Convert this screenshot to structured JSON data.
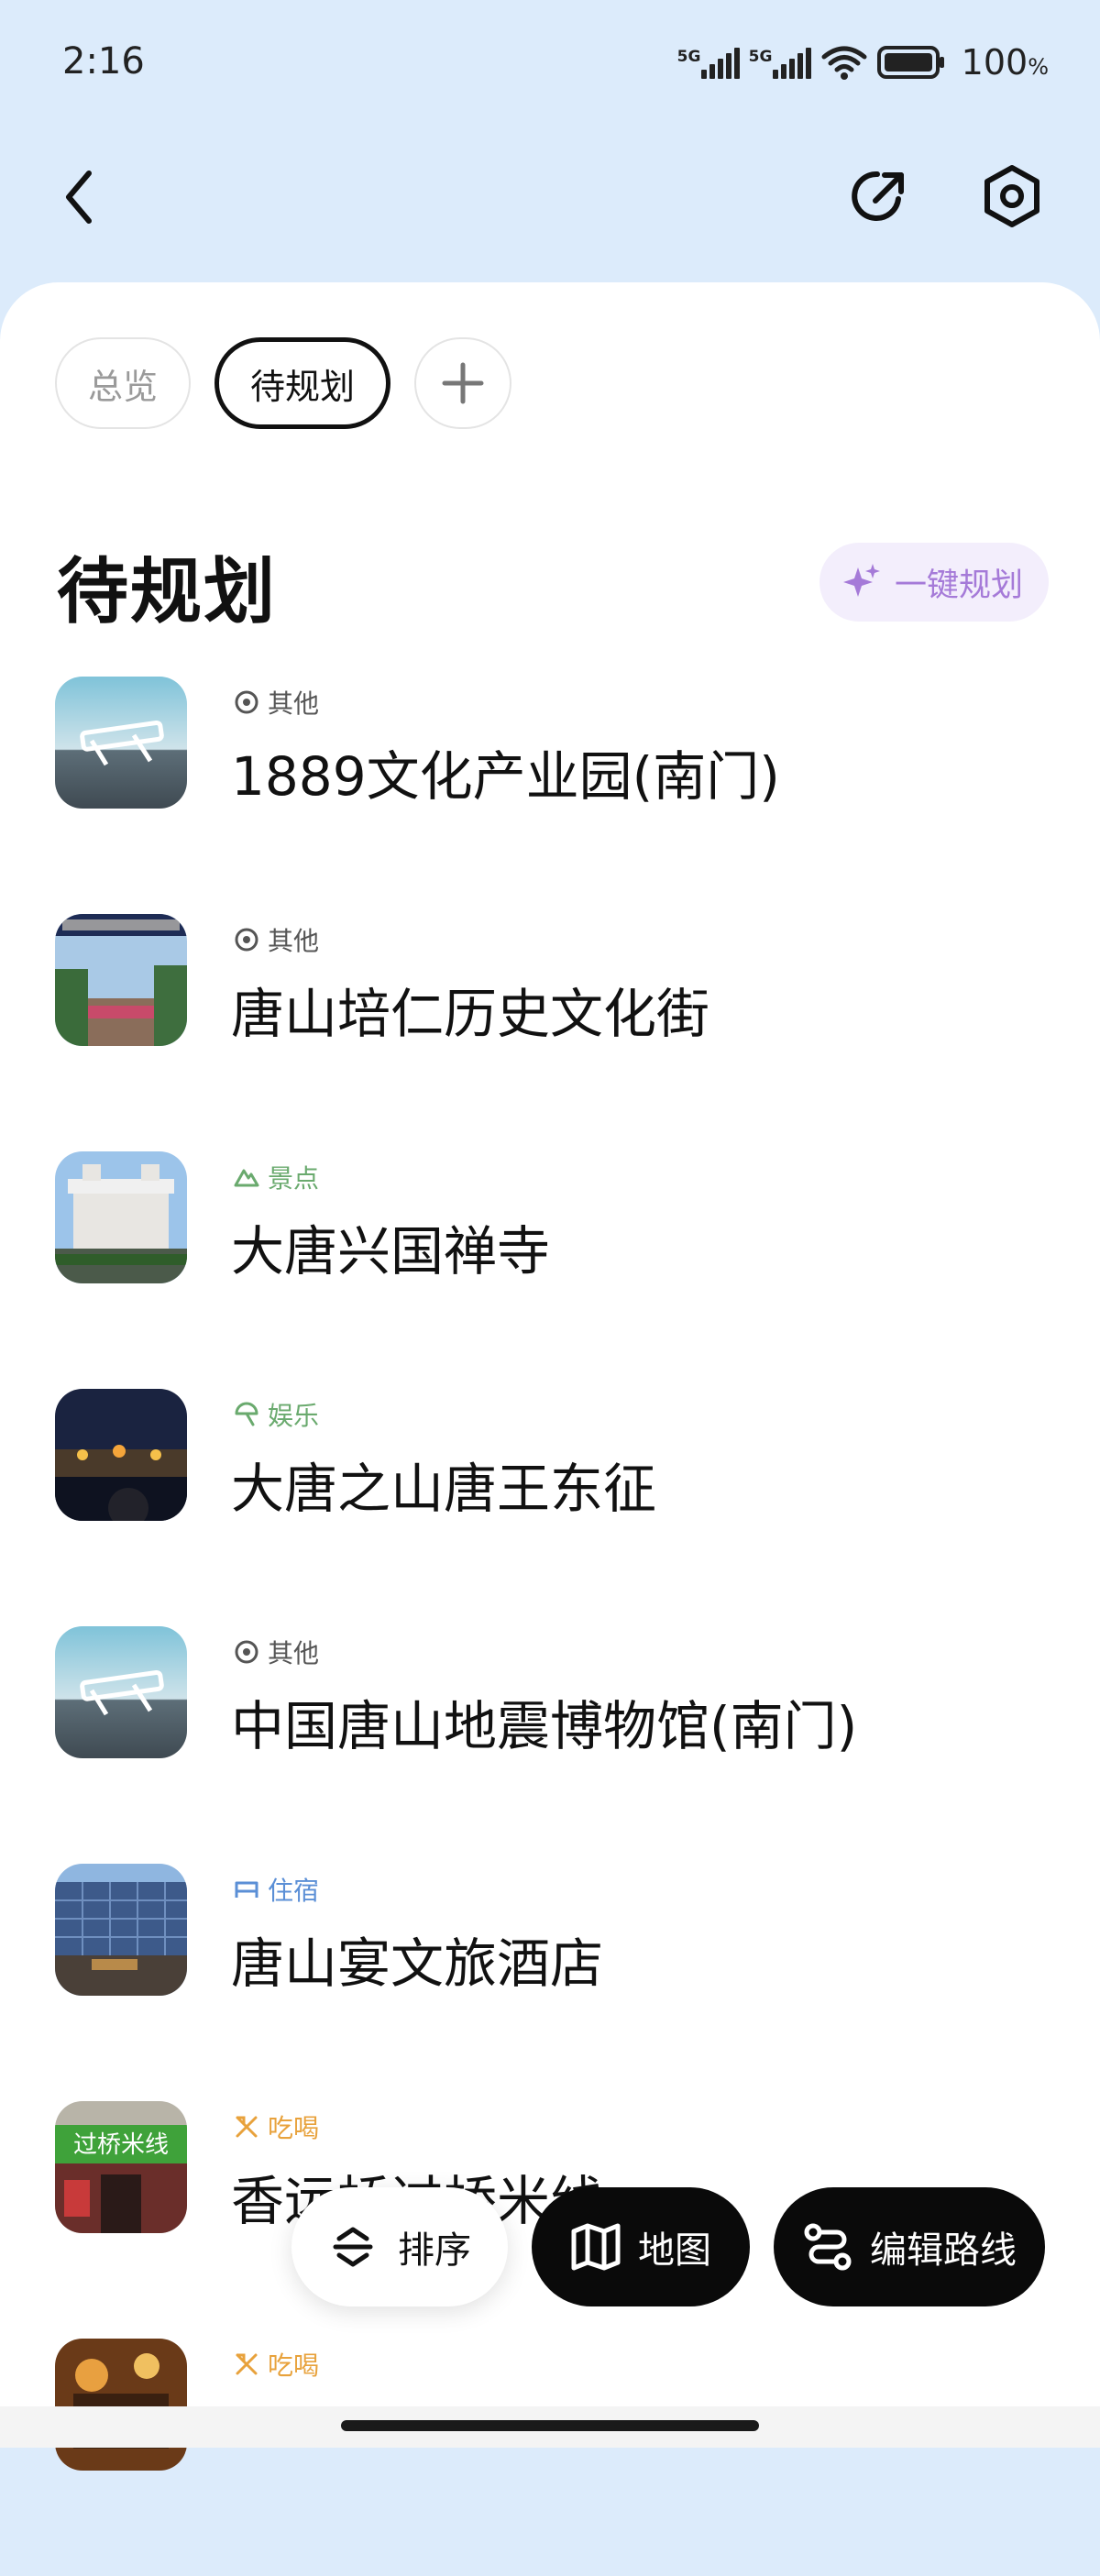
{
  "status_bar": {
    "time": "2:16",
    "network_1": "5G",
    "network_2": "5G",
    "battery": "100",
    "battery_unit": "%"
  },
  "topbar": {
    "back_icon": "chevron-left-icon",
    "share_icon": "share-arrow-icon",
    "settings_icon": "gear-icon"
  },
  "tabs": [
    {
      "label": "总览",
      "active": false
    },
    {
      "label": "待规划",
      "active": true
    }
  ],
  "add_tab_icon": "plus-icon",
  "section": {
    "title": "待规划",
    "plan_button": "一键规划"
  },
  "colors": {
    "header_bg": "#dcebfb",
    "category_other": "#555555",
    "category_scenic": "#6aaa6e",
    "category_entertainment": "#6aaa6e",
    "category_lodging": "#5b8fd6",
    "category_food": "#e8a23c",
    "plan_accent": "#a57ad8"
  },
  "places": [
    {
      "category": "其他",
      "icon": "location-pin-icon",
      "name": "1889文化产业园(南门)"
    },
    {
      "category": "其他",
      "icon": "location-pin-icon",
      "name": "唐山培仁历史文化街"
    },
    {
      "category": "景点",
      "icon": "mountain-icon",
      "name": "大唐兴国禅寺"
    },
    {
      "category": "娱乐",
      "icon": "umbrella-icon",
      "name": "大唐之山唐王东征"
    },
    {
      "category": "其他",
      "icon": "location-pin-icon",
      "name": "中国唐山地震博物馆(南门)"
    },
    {
      "category": "住宿",
      "icon": "bed-icon",
      "name": "唐山宴文旅酒店"
    },
    {
      "category": "吃喝",
      "icon": "utensils-icon",
      "name": "香远桥过桥米线"
    },
    {
      "category": "吃喝",
      "icon": "utensils-icon",
      "name": ""
    }
  ],
  "bottom_actions": {
    "sort": "排序",
    "map": "地图",
    "edit_route": "编辑路线"
  }
}
